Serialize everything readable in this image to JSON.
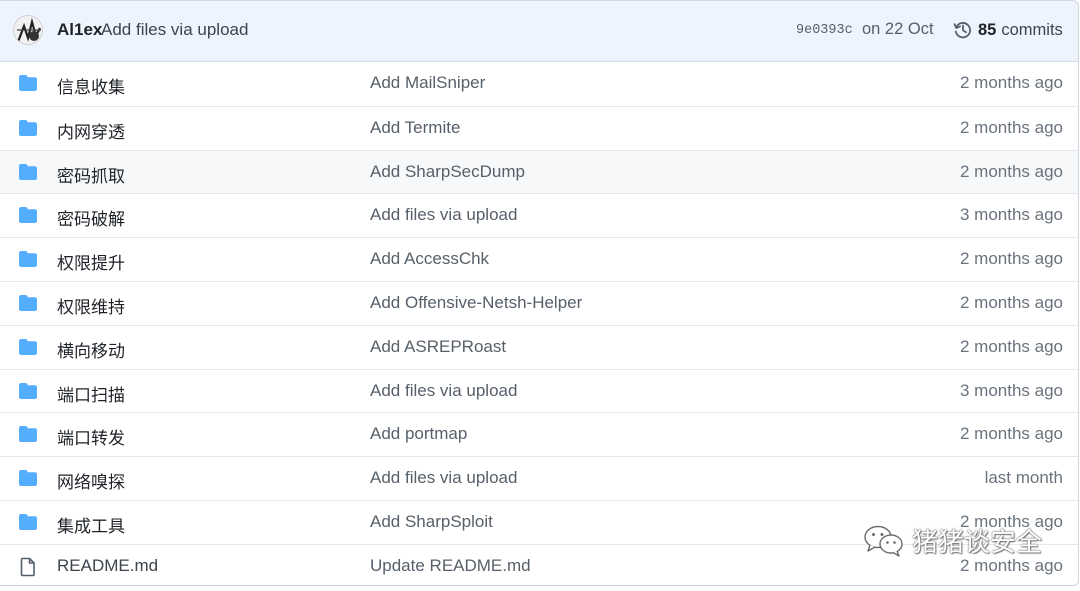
{
  "commit": {
    "author": "Al1ex",
    "message": "Add files via upload",
    "sha": "9e0393c",
    "date": "on 22 Oct",
    "commit_count": "85",
    "commit_label": "commits"
  },
  "rows": [
    {
      "name": "信息收集",
      "type": "folder",
      "message": "Add MailSniper",
      "age": "2 months ago"
    },
    {
      "name": "内网穿透",
      "type": "folder",
      "message": "Add Termite",
      "age": "2 months ago"
    },
    {
      "name": "密码抓取",
      "type": "folder",
      "message": "Add SharpSecDump",
      "age": "2 months ago"
    },
    {
      "name": "密码破解",
      "type": "folder",
      "message": "Add files via upload",
      "age": "3 months ago"
    },
    {
      "name": "权限提升",
      "type": "folder",
      "message": "Add AccessChk",
      "age": "2 months ago"
    },
    {
      "name": "权限维持",
      "type": "folder",
      "message": "Add Offensive-Netsh-Helper",
      "age": "2 months ago"
    },
    {
      "name": "横向移动",
      "type": "folder",
      "message": "Add ASREPRoast",
      "age": "2 months ago"
    },
    {
      "name": "端口扫描",
      "type": "folder",
      "message": "Add files via upload",
      "age": "3 months ago"
    },
    {
      "name": "端口转发",
      "type": "folder",
      "message": "Add portmap",
      "age": "2 months ago"
    },
    {
      "name": "网络嗅探",
      "type": "folder",
      "message": "Add files via upload",
      "age": "last month"
    },
    {
      "name": "集成工具",
      "type": "folder",
      "message": "Add SharpSploit",
      "age": "2 months ago"
    },
    {
      "name": "README.md",
      "type": "file",
      "message": "Update README.md",
      "age": "2 months ago"
    }
  ],
  "watermark": {
    "text": "猪猪谈安全",
    "icon": "wechat-icon"
  },
  "colors": {
    "folder": "#54aeff",
    "header_bg": "#eef4fd",
    "border": "#d0d7de"
  }
}
